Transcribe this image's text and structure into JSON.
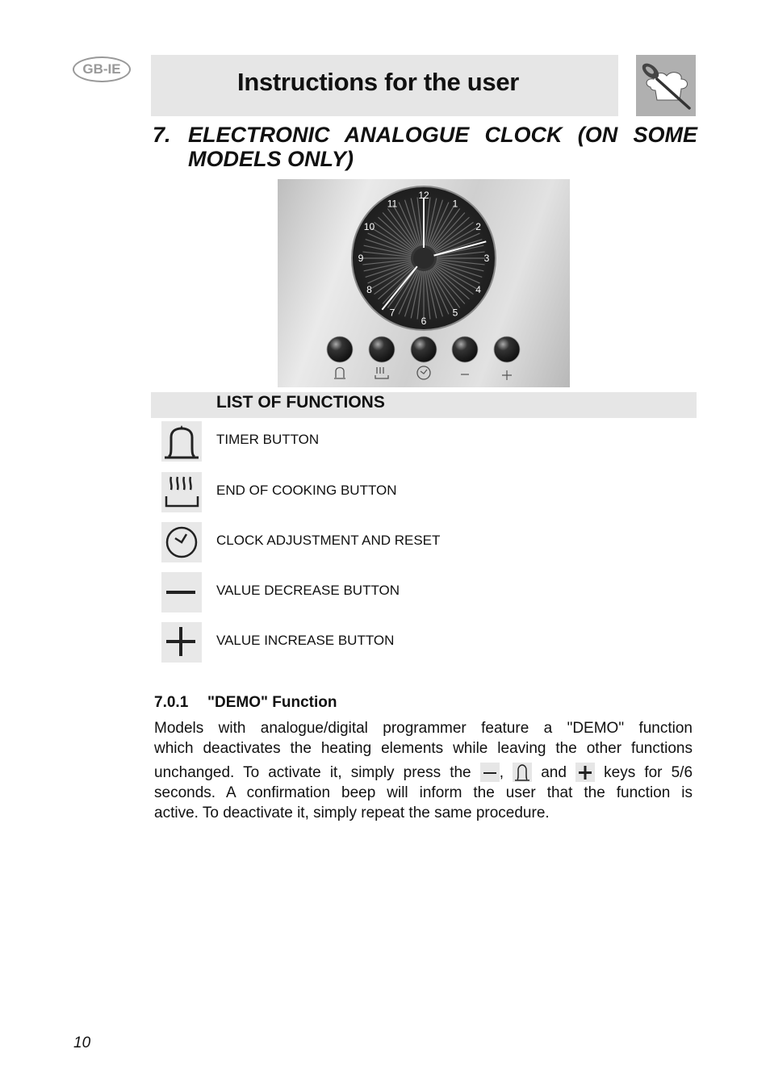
{
  "header": {
    "language_badge": "GB-IE",
    "title": "Instructions for the user",
    "logo_icon": "chef-hat-spoon-icon"
  },
  "section": {
    "number": "7.",
    "title": "ELECTRONIC ANALOGUE CLOCK (ON SOME MODELS ONLY)"
  },
  "clock_panel": {
    "dial_numbers": [
      "12",
      "1",
      "2",
      "3",
      "4",
      "5",
      "6",
      "7",
      "8",
      "9",
      "10",
      "11"
    ],
    "hands": {
      "hour_hand_points_to": 2.5,
      "minute_hand_points_to": 7.3,
      "second_hand_points_to": 12
    },
    "buttons": [
      {
        "icon": "bell-icon",
        "symbol": "timer"
      },
      {
        "icon": "steam-pot-icon",
        "symbol": "end-of-cooking"
      },
      {
        "icon": "clock-icon",
        "symbol": "clock"
      },
      {
        "icon": "minus-icon",
        "symbol": "−"
      },
      {
        "icon": "plus-icon",
        "symbol": "+"
      }
    ]
  },
  "functions": {
    "heading": "LIST OF FUNCTIONS",
    "items": [
      {
        "icon": "bell-icon",
        "label": "TIMER BUTTON"
      },
      {
        "icon": "steam-pot-icon",
        "label": "END OF COOKING BUTTON"
      },
      {
        "icon": "clock-icon",
        "label": "CLOCK ADJUSTMENT AND RESET"
      },
      {
        "icon": "minus-icon",
        "label": "VALUE DECREASE BUTTON"
      },
      {
        "icon": "plus-icon",
        "label": "VALUE INCREASE BUTTON"
      }
    ]
  },
  "demo": {
    "number": "7.0.1",
    "title": "\"DEMO\" Function",
    "line1": "Models with analogue/digital programmer feature a \"DEMO\" function",
    "line2": "which deactivates the heating elements while leaving the other functions",
    "line3_a": "unchanged. To activate it, simply press the",
    "line3_b": ",",
    "line3_c": "and",
    "line3_d": "keys for 5/6",
    "line4": "seconds. A confirmation beep will inform the user that the function is",
    "line5": "active. To deactivate it, simply repeat the same procedure."
  },
  "footer": {
    "page_number": "10"
  }
}
